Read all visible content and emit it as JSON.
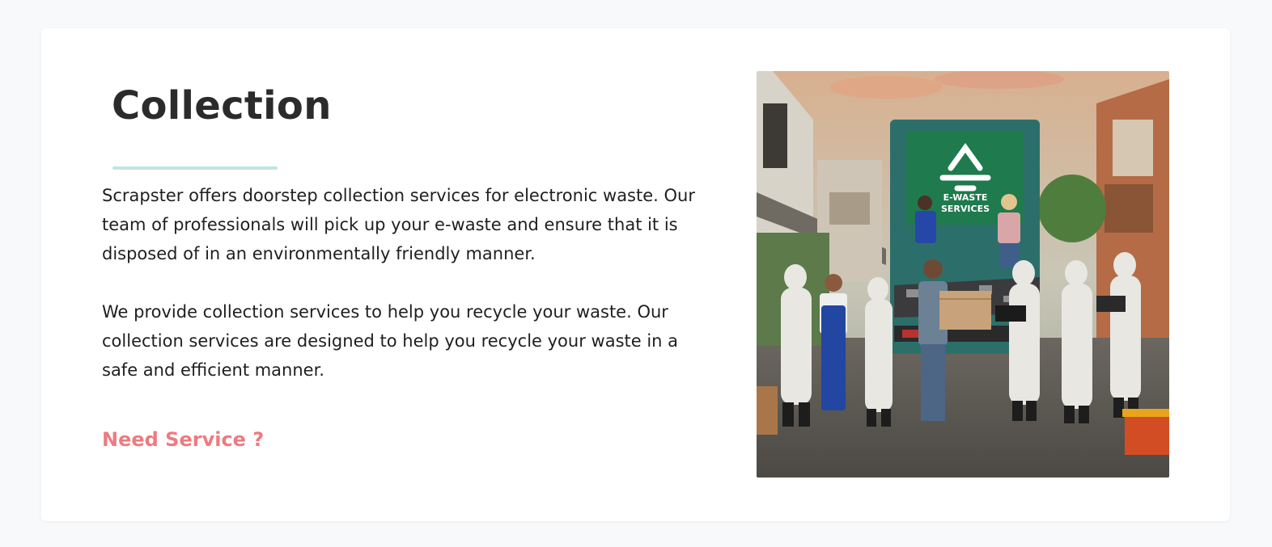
{
  "section": {
    "title": "Collection",
    "paragraphs": [
      "Scrapster offers doorstep collection services for electronic waste. Our team of professionals will pick up your e-waste and ensure that it is disposed of in an environmentally friendly manner.",
      "We provide collection services to help you recycle your waste. Our collection services are designed to help you recycle your waste in a safe and efficient manner."
    ],
    "cta_label": "Need Service ?"
  },
  "image": {
    "truck_sign_line1": "E-WASTE",
    "truck_sign_line2": "SERVICES"
  },
  "colors": {
    "accent_underline": "#bfe6e0",
    "cta": "#ef7a7f",
    "truck_green": "#1f7a4d"
  }
}
